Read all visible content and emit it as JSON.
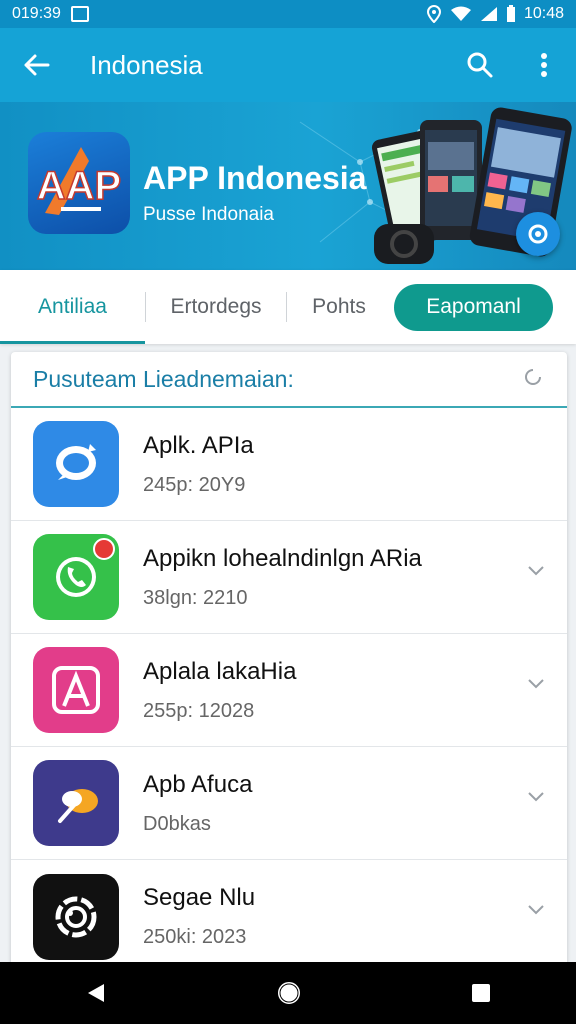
{
  "status_bar": {
    "time_left": "019:39",
    "time_right": "10:48"
  },
  "app_bar": {
    "title": "Indonesia"
  },
  "banner": {
    "title": "APP Indonesia",
    "subtitle": "Pusse Indonaia",
    "logo_text": "AAP"
  },
  "tabs": [
    {
      "label": "Antiliaa",
      "active": true
    },
    {
      "label": "Ertordegs",
      "active": false
    },
    {
      "label": "Pohts",
      "active": false
    }
  ],
  "primary_button": {
    "label": "Eapomanl"
  },
  "list": {
    "title": "Pusuteam Lieadnemaian:",
    "items": [
      {
        "name": "Aplk. APIa",
        "meta": "245p: 20Y9",
        "icon": "chat-bubble-icon",
        "color": "#2f8ae6"
      },
      {
        "name": "Appikn lohealndinlgn ARia",
        "meta": "38lgn: 2210",
        "icon": "whatsapp-phone-icon",
        "color": "#35c14a",
        "badge": true
      },
      {
        "name": "Aplala lakaHia",
        "meta": "255p: 12028",
        "icon": "letter-a-icon",
        "color": "#e23d8a"
      },
      {
        "name": "Apb Afuca",
        "meta": "D0bkas",
        "icon": "feather-icon",
        "color": "#3e3a8c"
      },
      {
        "name": "Segae Nlu",
        "meta": "250ki: 2023",
        "icon": "circle-gear-icon",
        "color": "#111111"
      }
    ]
  },
  "colors": {
    "accent": "#16959f",
    "app_bar": "#15a3d6",
    "status_bar": "#0d8ec4"
  }
}
